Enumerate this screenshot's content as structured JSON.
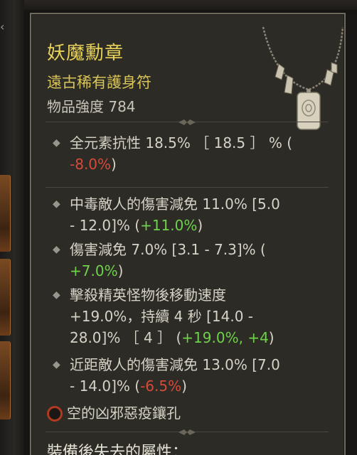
{
  "item": {
    "name": "妖魔勳章",
    "type": "遠古稀有護身符",
    "power": "物品強度 784"
  },
  "affixes": [
    {
      "id": "all-resist",
      "line1_text": "全元素抗性 18.5%  ［ 18.5 ］ % (",
      "line2_neg": "-8.0%",
      "line2_tail": ")"
    },
    {
      "id": "poison-dr",
      "line1_text": "中毒敵人的傷害減免 11.0% [5.0",
      "line2_text": "- 12.0]% (",
      "line2_pos": "+11.0%",
      "line2_tail": ")"
    },
    {
      "id": "dr",
      "line1_text": "傷害減免 7.0% [3.1 - 7.3]% (",
      "line2_pos": "+7.0%",
      "line2_tail": ")"
    },
    {
      "id": "elite-speed",
      "line1_text": "擊殺精英怪物後移動速度",
      "line2_text": "+19.0%，持續 4 秒 [14.0 -",
      "line3_text": "28.0]% ［ 4 ］ (",
      "line3_pos1": "+19.0%",
      "line3_sep": ", ",
      "line3_pos2": "+4",
      "line3_tail": ")"
    },
    {
      "id": "close-dr",
      "line1_text": "近距敵人的傷害減免 13.0% [7.0",
      "line2_text": "- 14.0]% (",
      "line2_neg": "-6.5%",
      "line2_tail": ")"
    }
  ],
  "socket": {
    "label": "空的凶邪惡疫鑲孔",
    "icon": "empty-socket-icon"
  },
  "lost_section": {
    "title": "裝備後失去的屬性："
  },
  "colors": {
    "item_name": "#e8d25a",
    "item_type": "#d9c45a",
    "negative": "#d74a3a",
    "positive": "#6ed24a",
    "text": "#d6d2c6"
  }
}
